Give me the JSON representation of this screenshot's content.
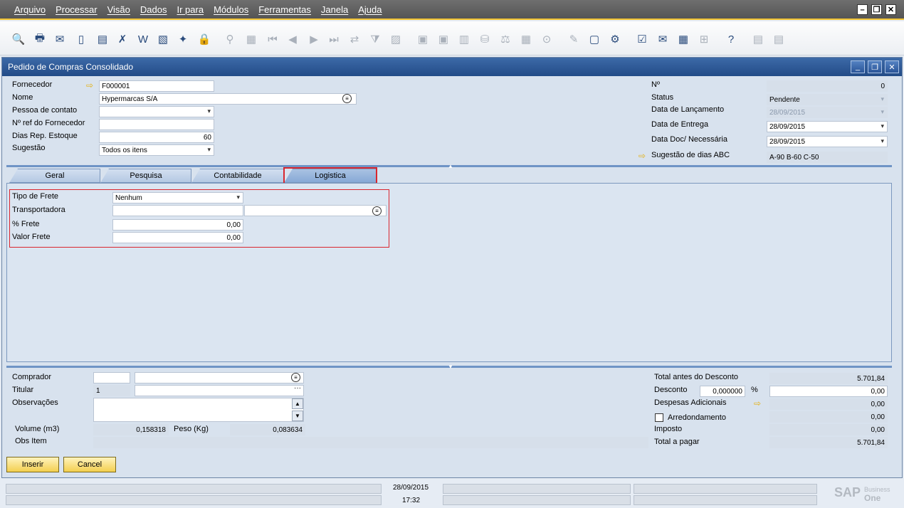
{
  "menu": [
    "Arquivo",
    "Processar",
    "Visão",
    "Dados",
    "Ir para",
    "Módulos",
    "Ferramentas",
    "Janela",
    "Ajuda"
  ],
  "window": {
    "title": "Pedido de Compras Consolidado"
  },
  "header_left": {
    "fornecedor_label": "Fornecedor",
    "fornecedor_value": "F000001",
    "nome_label": "Nome",
    "nome_value": "Hypermarcas S/A",
    "pessoa_label": "Pessoa de contato",
    "pessoa_value": "",
    "nref_label": "Nº ref do Fornecedor",
    "nref_value": "",
    "dias_label": "Dias Rep. Estoque",
    "dias_value": "60",
    "sugestao_label": "Sugestão",
    "sugestao_value": "Todos os itens"
  },
  "header_right": {
    "num_label": "Nº",
    "num_value": "0",
    "status_label": "Status",
    "status_value": "Pendente",
    "lanc_label": "Data de Lançamento",
    "lanc_value": "28/09/2015",
    "entrega_label": "Data de Entrega",
    "entrega_value": "28/09/2015",
    "doc_label": "Data Doc/ Necessária",
    "doc_value": "28/09/2015",
    "abc_label": "Sugestão de dias ABC",
    "abc_value": "A-90 B-60 C-50"
  },
  "tabs": [
    "Geral",
    "Pesquisa",
    "Contabilidade",
    "Logistica"
  ],
  "logistica": {
    "tipo_label": "Tipo de Frete",
    "tipo_value": "Nenhum",
    "transp_label": "Transportadora",
    "transp_code": "",
    "transp_name": "",
    "pfrete_label": "% Frete",
    "pfrete_value": "0,00",
    "vfrete_label": "Valor Frete",
    "vfrete_value": "0,00"
  },
  "footer_left": {
    "comprador_label": "Comprador",
    "comprador_code": "",
    "comprador_name": "",
    "titular_label": "Titular",
    "titular_code": "1",
    "titular_name": "",
    "obs_label": "Observações",
    "obs_value": "",
    "volume_label": "Volume (m3)",
    "volume_value": "0,158318",
    "peso_label": "Peso (Kg)",
    "peso_value": "0,083634",
    "obsitem_label": "Obs Item",
    "obsitem_value": ""
  },
  "footer_right": {
    "total_antes_label": "Total antes do Desconto",
    "total_antes_value": "5.701,84",
    "desconto_label": "Desconto",
    "desconto_pct": "0,000000",
    "pct_sign": "%",
    "desconto_value": "0,00",
    "despesas_label": "Despesas Adicionais",
    "despesas_value": "0,00",
    "arred_label": "Arredondamento",
    "arred_value": "0,00",
    "imposto_label": "Imposto",
    "imposto_value": "0,00",
    "total_label": "Total a pagar",
    "total_value": "5.701,84"
  },
  "buttons": {
    "inserir": "Inserir",
    "cancel": "Cancel"
  },
  "statusbar": {
    "date": "28/09/2015",
    "time": "17:32",
    "brand": "SAP",
    "brand_line1": "Business",
    "brand_line2": "One"
  },
  "colors": {
    "accent": "#f1c232",
    "title_bar": "#224b87",
    "highlight": "#d9262e"
  }
}
